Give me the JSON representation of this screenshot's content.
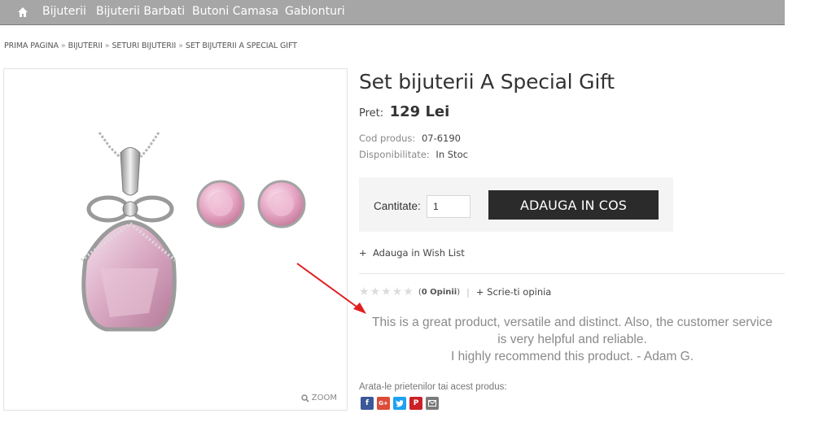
{
  "nav": {
    "home_icon": "home-icon",
    "items": [
      "Bijuterii",
      "Bijuterii Barbati",
      "Butoni Camasa",
      "Gablonturi"
    ]
  },
  "breadcrumb": [
    "PRIMA PAGINA",
    "BIJUTERII",
    "SETURI BIJUTERII",
    "SET BIJUTERII A SPECIAL GIFT"
  ],
  "gallery": {
    "zoom_label": "ZOOM",
    "zoom_icon": "search-icon"
  },
  "product": {
    "title": "Set bijuterii A Special Gift",
    "price_label": "Pret:",
    "price": "129 Lei",
    "code_label": "Cod produs:",
    "code": "07-6190",
    "availability_label": "Disponibilitate:",
    "availability": "In Stoc"
  },
  "cart": {
    "qty_label": "Cantitate:",
    "qty_value": "1",
    "add_button": "ADAUGA IN COS"
  },
  "wishlist_label": "Adauga in Wish List",
  "rating": {
    "stars": 0,
    "reviews_text": "0 Opinii",
    "write_review": "Scrie-ti opinia"
  },
  "testimonial": [
    "This is a great product, versatile and distinct. Also, the customer service",
    "is very helpful and reliable.",
    "I highly recommend this product. - Adam G."
  ],
  "share": {
    "label": "Arata-le prietenilor tai acest produs:",
    "icons": [
      "facebook-icon",
      "google-plus-icon",
      "twitter-icon",
      "pinterest-icon",
      "email-icon"
    ]
  },
  "colors": {
    "nav_bg": "#a6a6a6",
    "button_bg": "#2b2b2b",
    "arrow": "#e02020",
    "facebook": "#3b5998",
    "google_plus": "#dd4b39",
    "twitter": "#1da1f2",
    "pinterest": "#cb2027",
    "email": "#7a7a7a"
  }
}
